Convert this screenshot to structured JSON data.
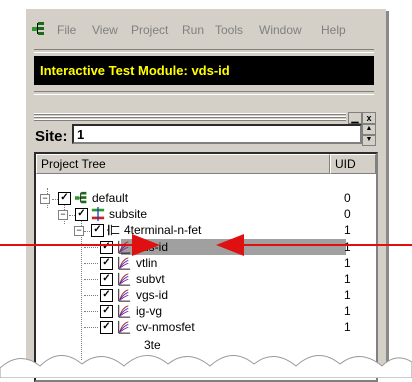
{
  "menu": [
    "File",
    "View",
    "Project",
    "Run",
    "Tools",
    "Window",
    "Help"
  ],
  "module_title": "Interactive Test Module: vds-id",
  "site": {
    "label": "Site:",
    "value": "1"
  },
  "tree": {
    "col_name": "Project Tree",
    "col_uid": "UID",
    "rows": [
      {
        "name": "default",
        "uid": "0"
      },
      {
        "name": "subsite",
        "uid": "0"
      },
      {
        "name": "4terminal-n-fet",
        "uid": "1"
      },
      {
        "name": "vds-id",
        "uid": "1"
      },
      {
        "name": "vtlin",
        "uid": "1"
      },
      {
        "name": "subvt",
        "uid": "1"
      },
      {
        "name": "vgs-id",
        "uid": "1"
      },
      {
        "name": "ig-vg",
        "uid": "1"
      },
      {
        "name": "cv-nmosfet",
        "uid": "1"
      }
    ],
    "partial_row": "3te"
  },
  "colors": {
    "arrow": "#e01010",
    "title_bg": "#000000",
    "title_fg": "#ffff00",
    "selection": "#a0a0a0"
  }
}
